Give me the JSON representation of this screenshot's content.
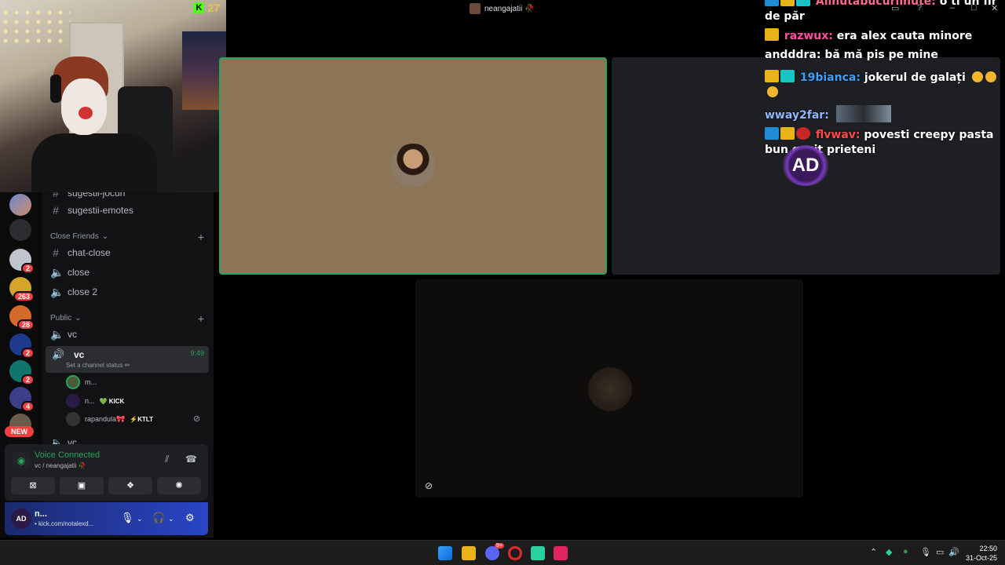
{
  "webcam": {
    "kick_count": "27",
    "kick_icon": "kick-logo-icon"
  },
  "topbar": {
    "call_title": "neangajatii 🥀"
  },
  "rail": {
    "servers": [
      {
        "name": "server-1",
        "badge": ""
      },
      {
        "name": "server-2",
        "badge": ""
      },
      {
        "name": "server-3",
        "badge": "2"
      },
      {
        "name": "server-4",
        "badge": "263"
      },
      {
        "name": "server-5",
        "badge": "28"
      },
      {
        "name": "server-6",
        "badge": "2"
      },
      {
        "name": "server-7",
        "badge": "2"
      },
      {
        "name": "server-8",
        "badge": "4"
      },
      {
        "name": "server-9",
        "badge": ""
      }
    ],
    "new_label": "NEW"
  },
  "channels": {
    "partial_top": "sugestii-jocuri",
    "sugestii_emotes": "sugestii-emotes",
    "cat_close_friends": "Close Friends",
    "chat_close": "chat-close",
    "close": "close",
    "close2": "close 2",
    "cat_public": "Public",
    "vc_first": "vc",
    "vc_active": "vc",
    "vc_active_time": "9:49",
    "vc_status": "Set a channel status ✏",
    "members": [
      {
        "name": "m...",
        "tag": ""
      },
      {
        "name": "n...",
        "tag": "💚 KICK"
      },
      {
        "name": "rapandula🎀",
        "tag": "⚡KTLT"
      }
    ],
    "partial_bottom": "vc"
  },
  "voice": {
    "status": "Voice Connected",
    "channel": "vc / neangajatii 🥀"
  },
  "user": {
    "name": "n...",
    "status": "• kick.com/notalexd...",
    "avatar_text": "AD"
  },
  "chat": {
    "messages": [
      {
        "user": "Alinutabucuriinute:",
        "text": "o ti un fir de păr",
        "color": "#ff6a8a"
      },
      {
        "user": "razwux:",
        "text": "era alex cauta minore",
        "color": "#ff4fa0"
      },
      {
        "user": "andddra:",
        "text": "bă mă pis pe mine",
        "color": "#ffffff"
      },
      {
        "user": "19bianca:",
        "text": "jokerul de galați",
        "color": "#3aa0ff"
      },
      {
        "user": "wway2far:",
        "text": "",
        "color": "#8fb8ff"
      },
      {
        "user": "flvwav:",
        "text": "povesti creepy pasta bun gasit prieteni",
        "color": "#ff4a4a"
      }
    ],
    "overlay_logo": "AD"
  },
  "taskbar": {
    "discord_badge": "9+",
    "time": "22:50",
    "date": "31-Oct-25"
  }
}
